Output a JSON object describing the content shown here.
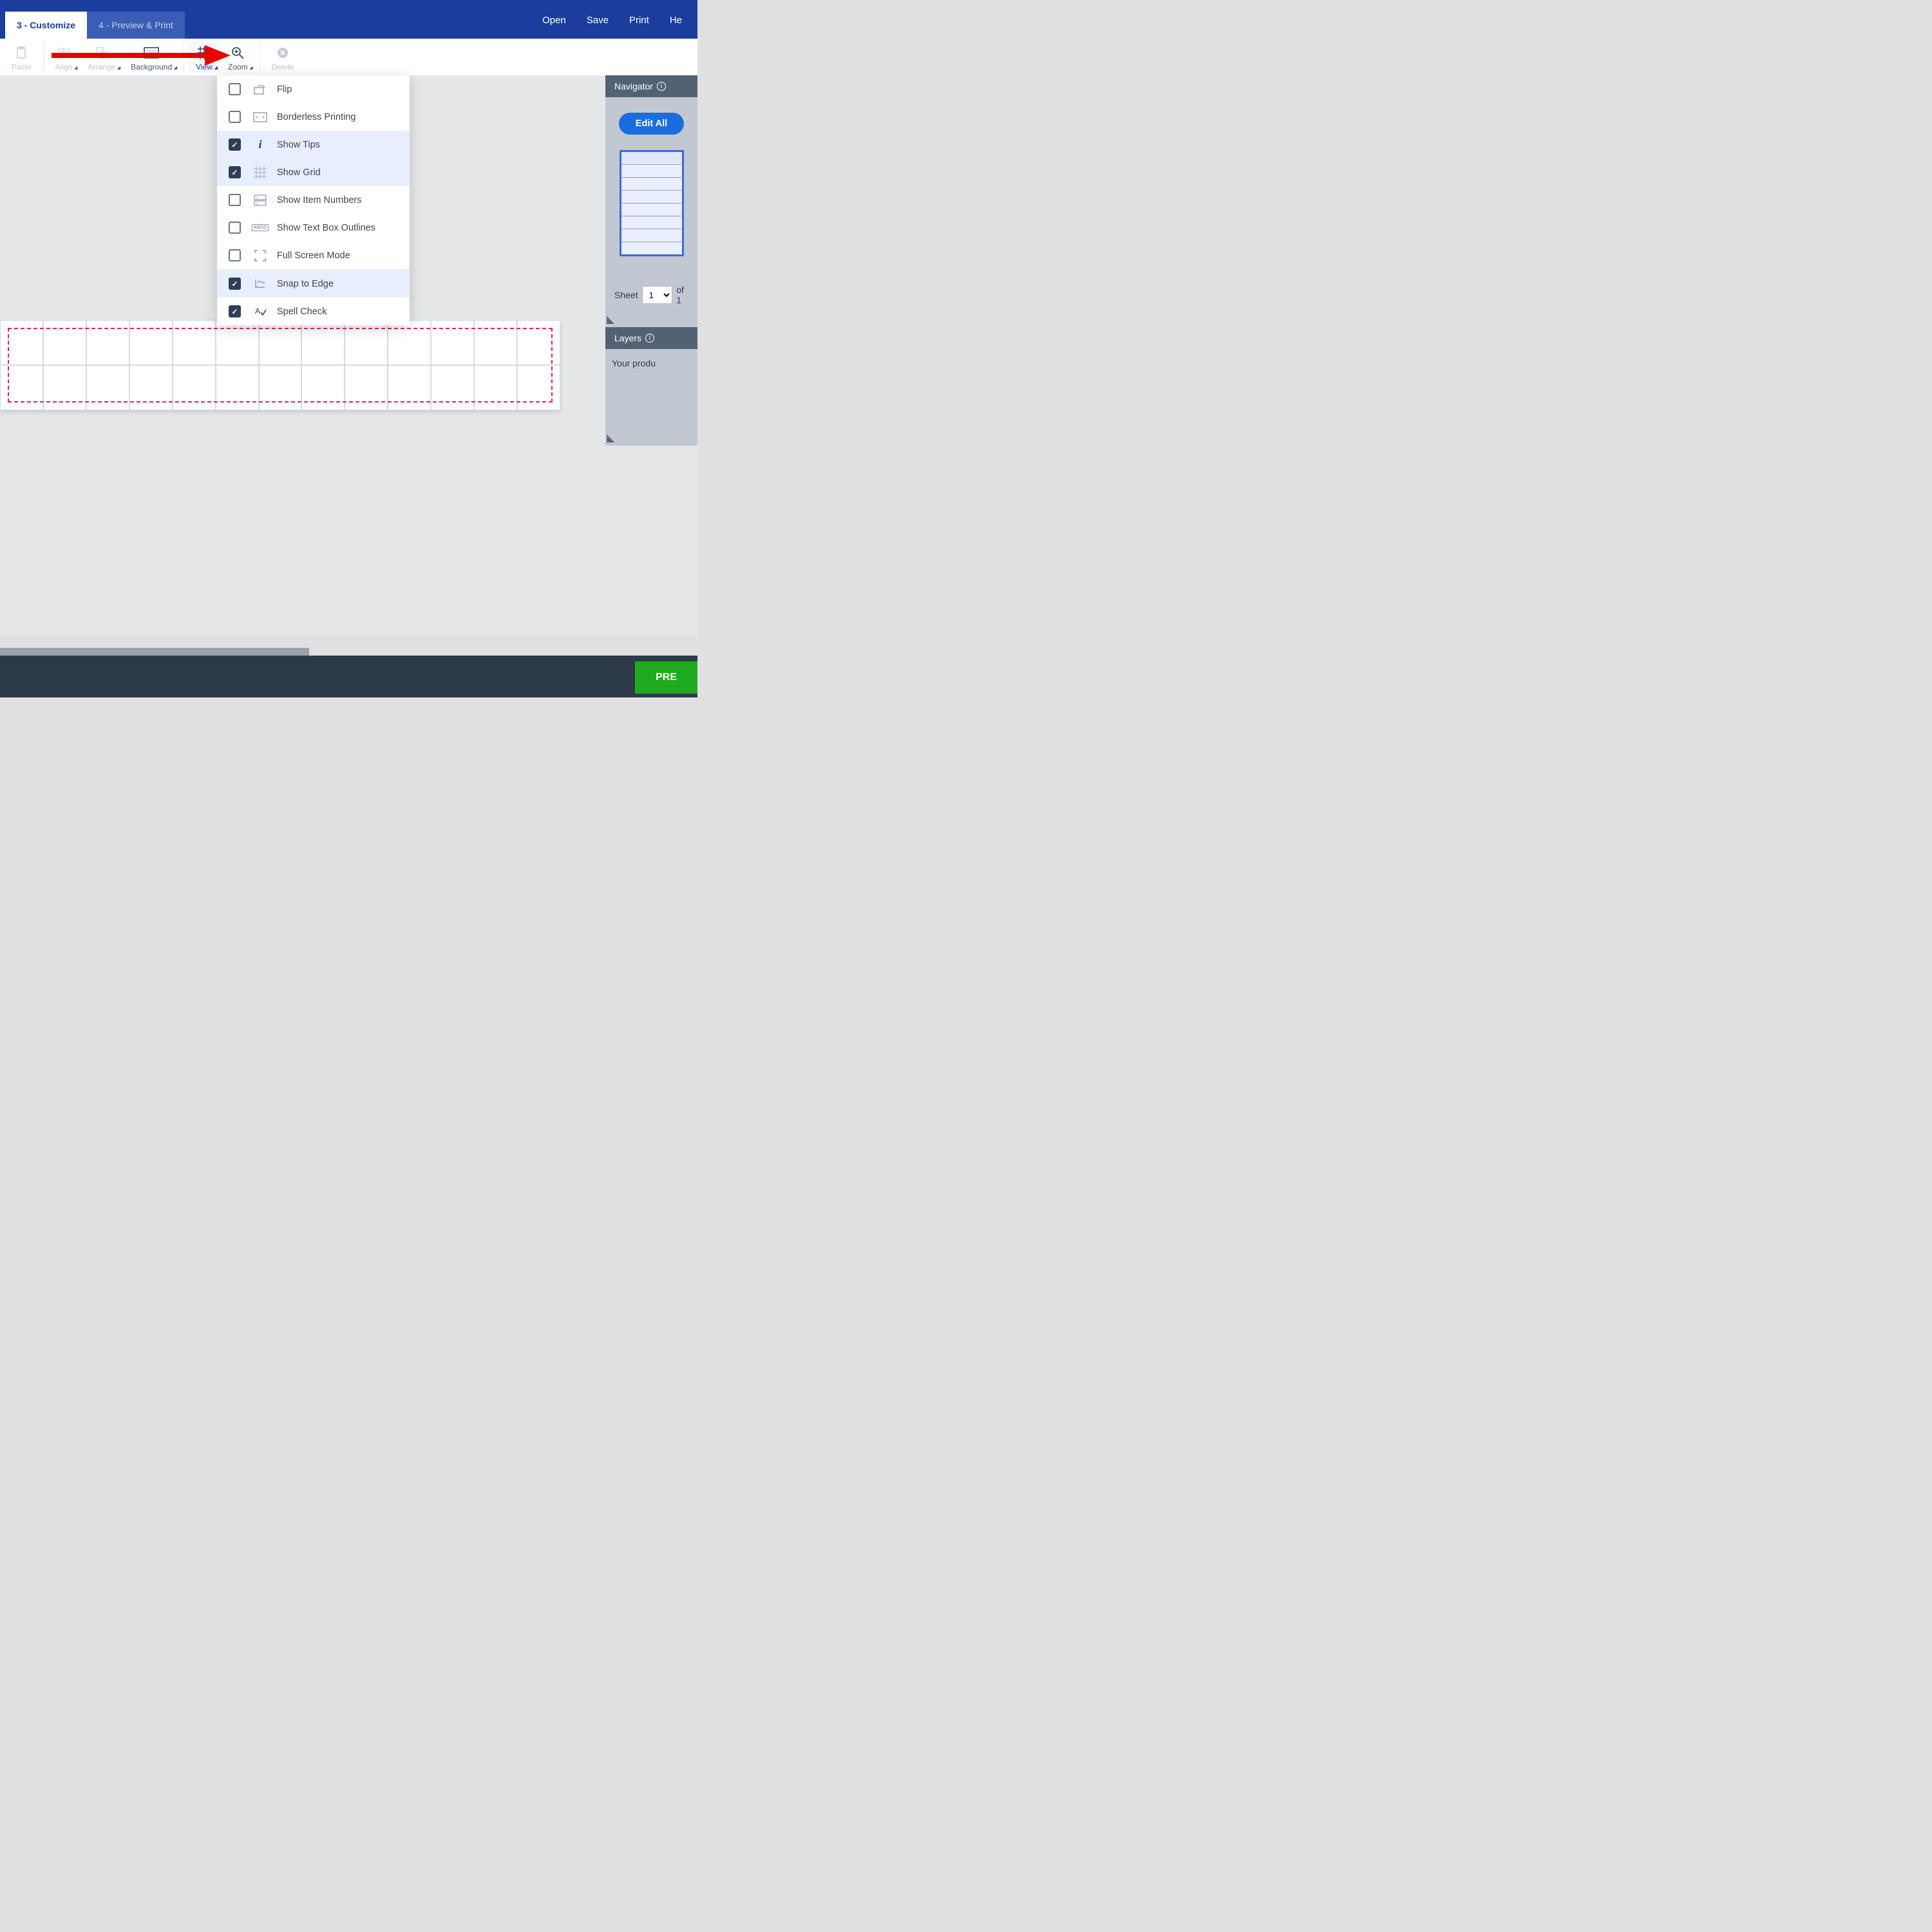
{
  "topbar": {
    "tabs": [
      {
        "label": "3 - Customize",
        "active": true
      },
      {
        "label": "4 - Preview & Print",
        "active": false
      }
    ],
    "menu": {
      "open": "Open",
      "save": "Save",
      "print": "Print",
      "help": "He"
    }
  },
  "toolbar": {
    "paste": "Paste",
    "align": "Align",
    "arrange": "Arrange",
    "background": "Background",
    "view": "View",
    "zoom": "Zoom",
    "delete": "Delete"
  },
  "view_menu": [
    {
      "label": "Flip",
      "checked": false,
      "icon": "flip",
      "hl": false
    },
    {
      "label": "Borderless Printing",
      "checked": false,
      "icon": "borderless",
      "hl": false
    },
    {
      "label": "Show Tips",
      "checked": true,
      "icon": "info",
      "hl": true
    },
    {
      "label": "Show Grid",
      "checked": true,
      "icon": "grid",
      "hl": true
    },
    {
      "label": "Show Item Numbers",
      "checked": false,
      "icon": "numbers",
      "hl": false
    },
    {
      "label": "Show Text Box Outlines",
      "checked": false,
      "icon": "abcd",
      "hl": false
    },
    {
      "label": "Full Screen Mode",
      "checked": false,
      "icon": "fullscreen",
      "hl": false
    },
    {
      "label": "Snap to Edge",
      "checked": true,
      "icon": "snap",
      "hl": true
    },
    {
      "label": "Spell Check",
      "checked": true,
      "icon": "spell",
      "hl": false
    }
  ],
  "navigator": {
    "title": "Navigator",
    "edit_all": "Edit All",
    "sheet_label": "Sheet",
    "sheet_value": "1",
    "sheet_suffix": "of 1"
  },
  "layers": {
    "title": "Layers",
    "message": "Your produ"
  },
  "footer": {
    "preview": "PRE"
  }
}
